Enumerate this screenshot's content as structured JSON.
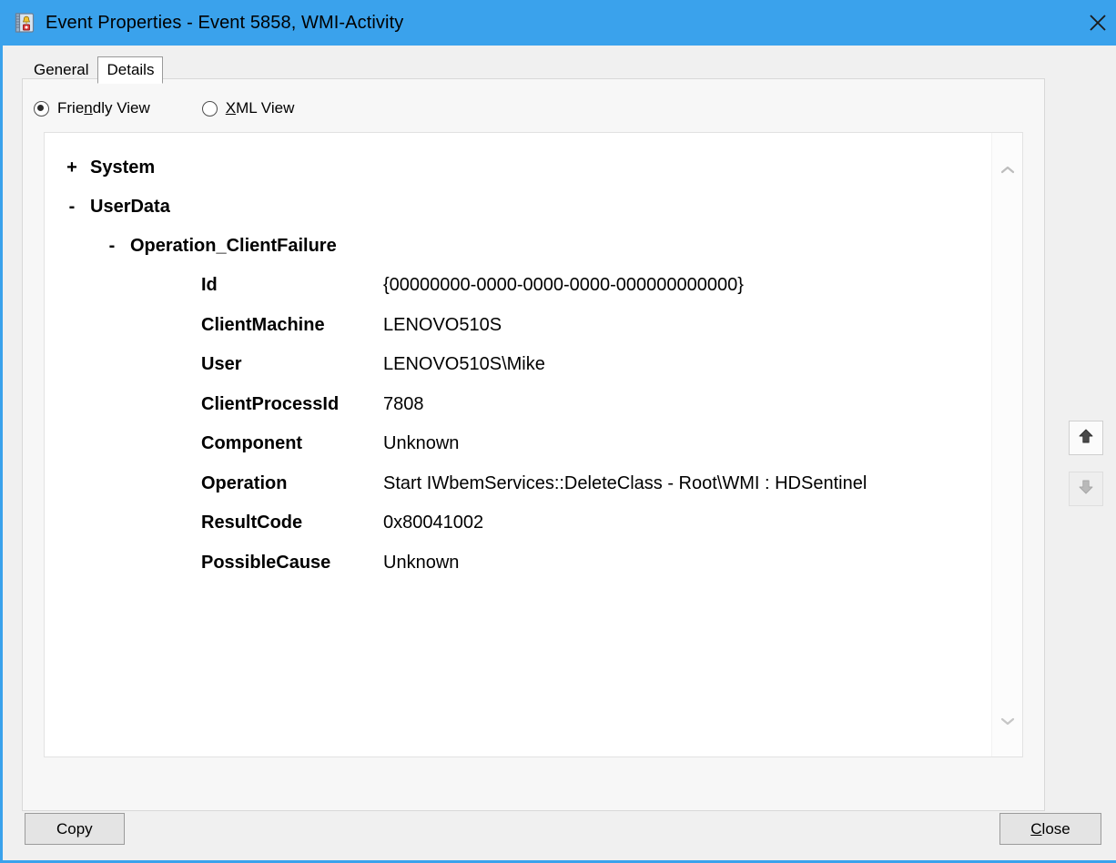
{
  "window": {
    "title": "Event Properties - Event 5858, WMI-Activity",
    "icon": "event-log-icon",
    "close_icon": "close-icon",
    "titlebar_color": "#3aa2ec",
    "border_color": "#3aa2ec"
  },
  "tabs": [
    {
      "label": "General",
      "selected": false
    },
    {
      "label": "Details",
      "selected": true
    }
  ],
  "view_modes": [
    {
      "label_before": "Frie",
      "accel": "n",
      "label_after": "dly View",
      "selected": true
    },
    {
      "label_before": "",
      "accel": "X",
      "label_after": "ML View",
      "selected": false
    }
  ],
  "tree": {
    "nodes": [
      {
        "twisty": "+",
        "label": "System",
        "level": 1
      },
      {
        "twisty": "-",
        "label": "UserData",
        "level": 1
      },
      {
        "twisty": "-",
        "label": "Operation_ClientFailure",
        "level": 2
      }
    ],
    "properties": [
      {
        "name": "Id",
        "value": "{00000000-0000-0000-0000-000000000000}"
      },
      {
        "name": "ClientMachine",
        "value": "LENOVO510S"
      },
      {
        "name": "User",
        "value": "LENOVO510S\\Mike"
      },
      {
        "name": "ClientProcessId",
        "value": "7808"
      },
      {
        "name": "Component",
        "value": "Unknown"
      },
      {
        "name": "Operation",
        "value": "Start IWbemServices::DeleteClass - Root\\WMI : HDSentinel"
      },
      {
        "name": "ResultCode",
        "value": "0x80041002"
      },
      {
        "name": "PossibleCause",
        "value": "Unknown"
      }
    ]
  },
  "scrollbar": {
    "up_icon": "chevron-up-icon",
    "down_icon": "chevron-down-icon"
  },
  "nav_buttons": [
    {
      "icon": "arrow-up-icon",
      "name": "previous-event-button",
      "enabled": true
    },
    {
      "icon": "arrow-down-icon",
      "name": "next-event-button",
      "enabled": false
    }
  ],
  "footer": {
    "copy_label": "Copy",
    "close_accel": "C",
    "close_label_after": "lose"
  }
}
